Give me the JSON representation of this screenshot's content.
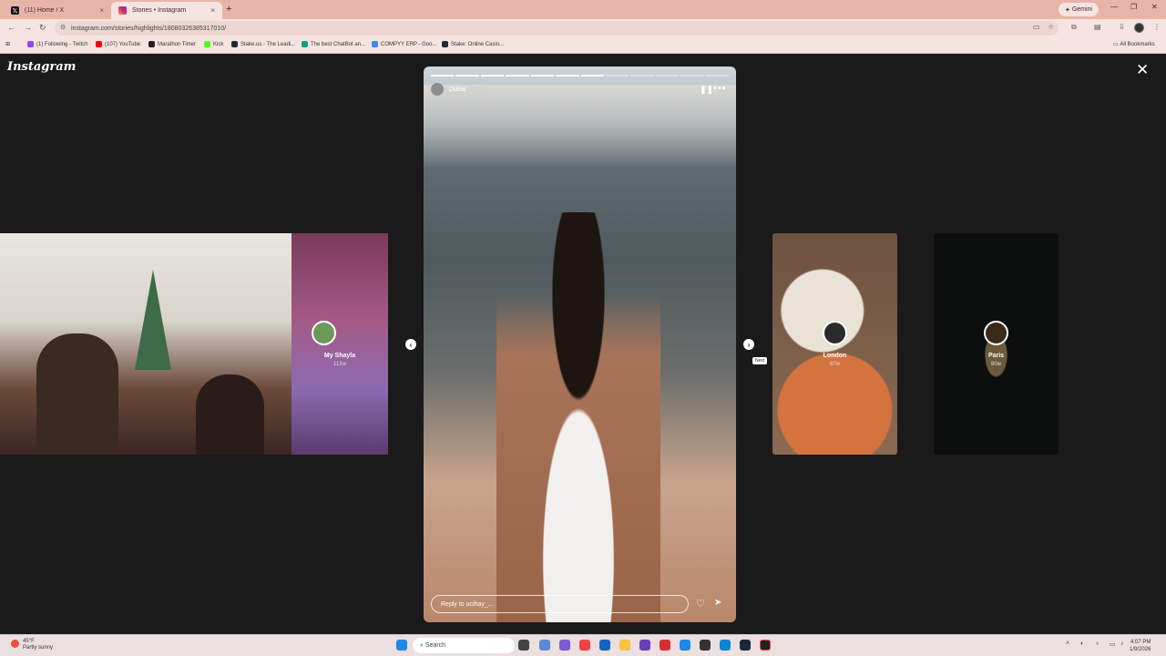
{
  "browser": {
    "tabs": [
      {
        "label": "(11) Home / X",
        "close": "×"
      },
      {
        "label": "Stories • Instagram",
        "close": "×"
      }
    ],
    "new_tab": "+",
    "gemini_label": "Gemini",
    "window_controls": {
      "minimize": "—",
      "maximize": "❐",
      "close": "✕"
    },
    "url": "instagram.com/stories/highlights/18080326385317010/",
    "all_bookmarks": "All Bookmarks",
    "bookmarks": [
      {
        "label": "(1) Following - Twitch",
        "color": "#9146ff"
      },
      {
        "label": "(107) YouTube",
        "color": "#ff0000"
      },
      {
        "label": "Marathon Timer",
        "color": "#222222"
      },
      {
        "label": "Kick",
        "color": "#53fc18"
      },
      {
        "label": "Stake.us - The Leadi...",
        "color": "#1a2c38"
      },
      {
        "label": "The best ChatBot an...",
        "color": "#10a37f"
      },
      {
        "label": "COMPYY ERP - Goo...",
        "color": "#4285f4"
      },
      {
        "label": "Stake: Online Casin...",
        "color": "#1a2c38"
      }
    ]
  },
  "instagram": {
    "logo": "Instagram",
    "close": "✕",
    "story": {
      "username": "Dubai",
      "time": "115w",
      "progress_segments": 12,
      "progress_done": 7,
      "reply_placeholder": "Reply to ucihay_...",
      "next_tooltip": "Next"
    },
    "side_stories": [
      {
        "label": "My Shayla",
        "time": "113w"
      },
      {
        "label": "London",
        "time": "87w"
      },
      {
        "label": "Paris",
        "time": "80w"
      }
    ]
  },
  "taskbar": {
    "weather_temp": "45°F",
    "weather_desc": "Partly sunny",
    "search_label": "Search",
    "time": "4:07 PM",
    "date": "1/9/2026"
  },
  "colors": {
    "accent_tab": "#f5e4e0",
    "tabstrip": "#e8b4aa",
    "stage_bg": "#1a1a1a"
  }
}
